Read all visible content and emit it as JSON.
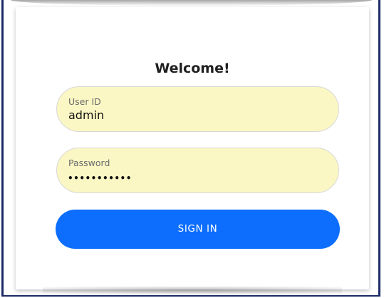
{
  "login": {
    "title": "Welcome!",
    "user_id": {
      "label": "User ID",
      "value": "admin"
    },
    "password": {
      "label": "Password",
      "masked_value": "•••••••••••"
    },
    "sign_in_label": "SIGN IN"
  },
  "colors": {
    "input_background": "#fbf7c4",
    "primary_button": "#0d6efd",
    "frame_border": "#1c2a66"
  }
}
